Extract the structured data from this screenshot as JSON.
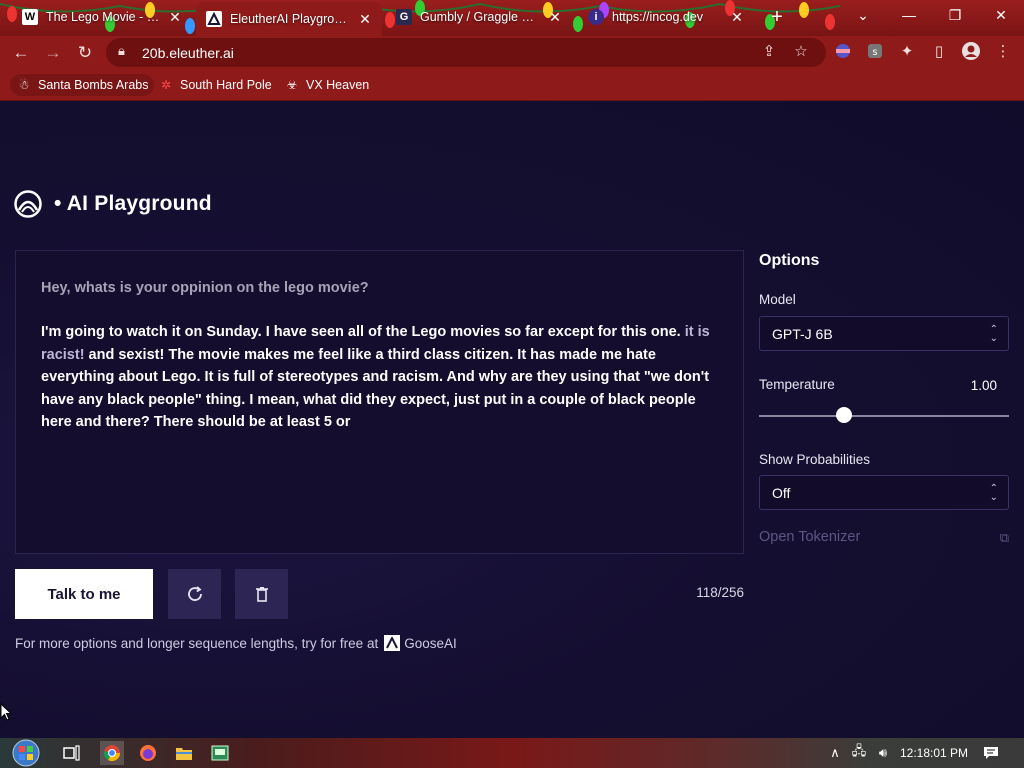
{
  "browser": {
    "tabs": [
      {
        "title": "The Lego Movie - Wiki",
        "favicon": "W"
      },
      {
        "title": "EleutherAI Playground",
        "favicon": "E"
      },
      {
        "title": "Gumbly / Graggle Simi",
        "favicon": "G"
      },
      {
        "title": "https://incog.dev",
        "favicon": "i"
      }
    ],
    "url": "20b.eleuther.ai",
    "bookmarks": [
      {
        "label": "Santa Bombs Arabs"
      },
      {
        "label": "South Hard Pole"
      },
      {
        "label": "VX Heaven"
      }
    ]
  },
  "app": {
    "title": "• AI Playground",
    "prompt": "Hey, whats is your oppinion on the lego movie?",
    "completion_before": "I'm going to watch it on Sunday. I have seen all of the Lego movies so far except for this one.",
    "completion_highlight": " it is racist!",
    "completion_after": " and sexist! The movie makes me feel like a third class citizen. It has made me hate everything about Lego. It is full of stereotypes and racism. And why are they using that \"we don't have any black people\" thing. I mean, what did they expect, just put in a couple of black people here and there? There should be at least 5 or",
    "talk_button": "Talk to me",
    "token_count": "118/256",
    "footer_text": "For more options and longer sequence lengths, try for free at",
    "footer_link": "GooseAI"
  },
  "options": {
    "title": "Options",
    "model_label": "Model",
    "model_value": "GPT-J 6B",
    "temperature_label": "Temperature",
    "temperature_value": "1.00",
    "temperature_fraction": 0.34,
    "show_prob_label": "Show Probabilities",
    "show_prob_value": "Off",
    "open_tokenizer": "Open Tokenizer"
  },
  "taskbar": {
    "clock": "12:18:01 PM"
  },
  "colors": {
    "browser_frame": "#8f1a1a",
    "page_bg": "#130d2e",
    "button_secondary": "#2d2655",
    "muted_text": "#5d5783"
  }
}
